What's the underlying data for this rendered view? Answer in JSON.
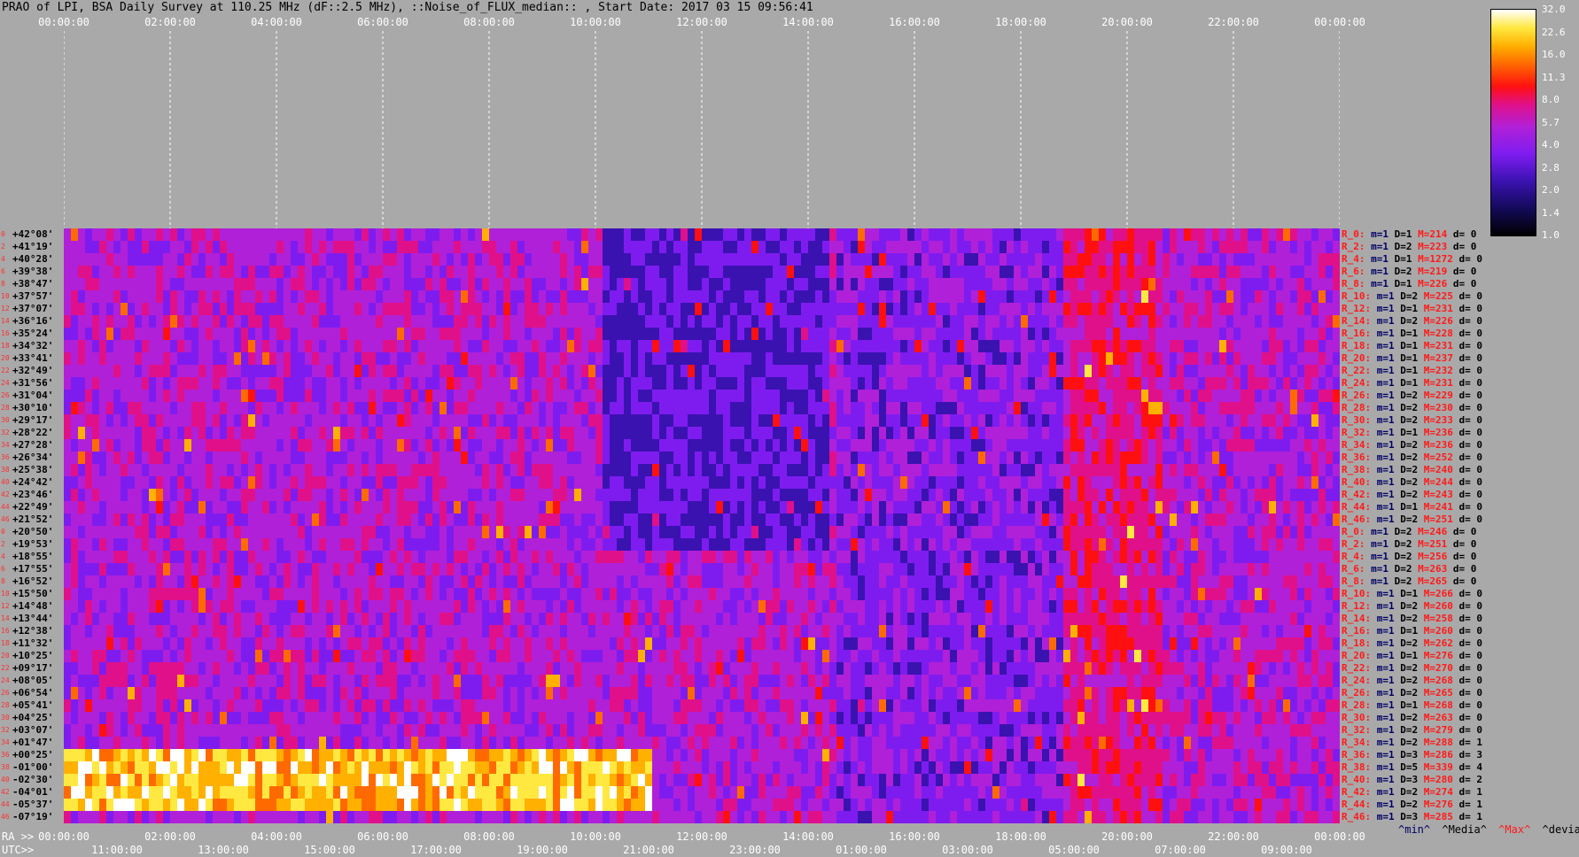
{
  "title": "PRAO of LPI, BSA Daily Survey at 110.25 MHz (dF::2.5 MHz), ::Noise_of_FLUX_median:: , Start Date: 2017 03 15 09:56:41",
  "chart_data": {
    "type": "heatmap",
    "title": "PRAO of LPI, BSA Daily Survey at 110.25 MHz (dF::2.5 MHz), ::Noise_of_FLUX_median:: , Start Date: 2017 03 15 09:56:41",
    "top_axis_ticks": [
      "00:00:00",
      "02:00:00",
      "04:00:00",
      "06:00:00",
      "08:00:00",
      "10:00:00",
      "12:00:00",
      "14:00:00",
      "16:00:00",
      "18:00:00",
      "20:00:00",
      "22:00:00",
      "00:00:00"
    ],
    "ra_axis_prefix": "RA >>",
    "ra_axis_ticks": [
      "00:00:00",
      "02:00:00",
      "04:00:00",
      "06:00:00",
      "08:00:00",
      "10:00:00",
      "12:00:00",
      "14:00:00",
      "16:00:00",
      "18:00:00",
      "20:00:00",
      "22:00:00",
      "00:00:00"
    ],
    "utc_axis_prefix": "UTC>>",
    "utc_axis_ticks": [
      "11:00:00",
      "13:00:00",
      "15:00:00",
      "17:00:00",
      "19:00:00",
      "21:00:00",
      "23:00:00",
      "01:00:00",
      "03:00:00",
      "05:00:00",
      "07:00:00",
      "09:00:00"
    ],
    "colorbar": {
      "ticks": [
        "32.0",
        "22.6",
        "16.0",
        "11.3",
        "8.0",
        "5.7",
        "4.0",
        "2.8",
        "2.0",
        "1.4",
        "1.0"
      ],
      "colors": [
        "#000000",
        "#3a12b0",
        "#7e1cf0",
        "#b020d8",
        "#e0108a",
        "#ff1010",
        "#ff6a00",
        "#ffb000",
        "#ffe840",
        "#ffffff"
      ]
    },
    "rows": [
      {
        "idx": "0",
        "dec": "+42°08'"
      },
      {
        "idx": "2",
        "dec": "+41°19'"
      },
      {
        "idx": "4",
        "dec": "+40°28'"
      },
      {
        "idx": "6",
        "dec": "+39°38'"
      },
      {
        "idx": "8",
        "dec": "+38°47'"
      },
      {
        "idx": "10",
        "dec": "+37°57'"
      },
      {
        "idx": "12",
        "dec": "+37°07'"
      },
      {
        "idx": "14",
        "dec": "+36°16'"
      },
      {
        "idx": "16",
        "dec": "+35°24'"
      },
      {
        "idx": "18",
        "dec": "+34°32'"
      },
      {
        "idx": "20",
        "dec": "+33°41'"
      },
      {
        "idx": "22",
        "dec": "+32°49'"
      },
      {
        "idx": "24",
        "dec": "+31°56'"
      },
      {
        "idx": "26",
        "dec": "+31°04'"
      },
      {
        "idx": "28",
        "dec": "+30°10'"
      },
      {
        "idx": "30",
        "dec": "+29°17'"
      },
      {
        "idx": "32",
        "dec": "+28°22'"
      },
      {
        "idx": "34",
        "dec": "+27°28'"
      },
      {
        "idx": "36",
        "dec": "+26°34'"
      },
      {
        "idx": "38",
        "dec": "+25°38'"
      },
      {
        "idx": "40",
        "dec": "+24°42'"
      },
      {
        "idx": "42",
        "dec": "+23°46'"
      },
      {
        "idx": "44",
        "dec": "+22°49'"
      },
      {
        "idx": "46",
        "dec": "+21°52'"
      },
      {
        "idx": "0",
        "dec": "+20°50'"
      },
      {
        "idx": "2",
        "dec": "+19°53'"
      },
      {
        "idx": "4",
        "dec": "+18°55'"
      },
      {
        "idx": "6",
        "dec": "+17°55'"
      },
      {
        "idx": "8",
        "dec": "+16°52'"
      },
      {
        "idx": "10",
        "dec": "+15°50'"
      },
      {
        "idx": "12",
        "dec": "+14°48'"
      },
      {
        "idx": "14",
        "dec": "+13°44'"
      },
      {
        "idx": "16",
        "dec": "+12°38'"
      },
      {
        "idx": "18",
        "dec": "+11°32'"
      },
      {
        "idx": "20",
        "dec": "+10°25'"
      },
      {
        "idx": "22",
        "dec": "+09°17'"
      },
      {
        "idx": "24",
        "dec": "+08°05'"
      },
      {
        "idx": "26",
        "dec": "+06°54'"
      },
      {
        "idx": "28",
        "dec": "+05°41'"
      },
      {
        "idx": "30",
        "dec": "+04°25'"
      },
      {
        "idx": "32",
        "dec": "+03°07'"
      },
      {
        "idx": "34",
        "dec": "+01°47'"
      },
      {
        "idx": "36",
        "dec": "+00°25'"
      },
      {
        "idx": "38",
        "dec": "-01°00'"
      },
      {
        "idx": "40",
        "dec": "-02°30'"
      },
      {
        "idx": "42",
        "dec": "-04°01'"
      },
      {
        "idx": "44",
        "dec": "-05°37'"
      },
      {
        "idx": "46",
        "dec": "-07°19'"
      }
    ],
    "stats": [
      {
        "r": "R_0:",
        "m": "m=1",
        "d": "D=1",
        "mx": "M=214",
        "dv": "d= 0"
      },
      {
        "r": "R_2:",
        "m": "m=1",
        "d": "D=2",
        "mx": "M=223",
        "dv": "d= 0"
      },
      {
        "r": "R_4:",
        "m": "m=1",
        "d": "D=1",
        "mx": "M=1272",
        "dv": "d= 0"
      },
      {
        "r": "R_6:",
        "m": "m=1",
        "d": "D=2",
        "mx": "M=219",
        "dv": "d= 0"
      },
      {
        "r": "R_8:",
        "m": "m=1",
        "d": "D=1",
        "mx": "M=226",
        "dv": "d= 0"
      },
      {
        "r": "R_10:",
        "m": "m=1",
        "d": "D=2",
        "mx": "M=225",
        "dv": "d= 0"
      },
      {
        "r": "R_12:",
        "m": "m=1",
        "d": "D=1",
        "mx": "M=231",
        "dv": "d= 0"
      },
      {
        "r": "R_14:",
        "m": "m=1",
        "d": "D=2",
        "mx": "M=226",
        "dv": "d= 0"
      },
      {
        "r": "R_16:",
        "m": "m=1",
        "d": "D=1",
        "mx": "M=228",
        "dv": "d= 0"
      },
      {
        "r": "R_18:",
        "m": "m=1",
        "d": "D=1",
        "mx": "M=231",
        "dv": "d= 0"
      },
      {
        "r": "R_20:",
        "m": "m=1",
        "d": "D=1",
        "mx": "M=237",
        "dv": "d= 0"
      },
      {
        "r": "R_22:",
        "m": "m=1",
        "d": "D=1",
        "mx": "M=232",
        "dv": "d= 0"
      },
      {
        "r": "R_24:",
        "m": "m=1",
        "d": "D=1",
        "mx": "M=231",
        "dv": "d= 0"
      },
      {
        "r": "R_26:",
        "m": "m=1",
        "d": "D=2",
        "mx": "M=229",
        "dv": "d= 0"
      },
      {
        "r": "R_28:",
        "m": "m=1",
        "d": "D=2",
        "mx": "M=230",
        "dv": "d= 0"
      },
      {
        "r": "R_30:",
        "m": "m=1",
        "d": "D=2",
        "mx": "M=233",
        "dv": "d= 0"
      },
      {
        "r": "R_32:",
        "m": "m=1",
        "d": "D=1",
        "mx": "M=236",
        "dv": "d= 0"
      },
      {
        "r": "R_34:",
        "m": "m=1",
        "d": "D=2",
        "mx": "M=236",
        "dv": "d= 0"
      },
      {
        "r": "R_36:",
        "m": "m=1",
        "d": "D=2",
        "mx": "M=252",
        "dv": "d= 0"
      },
      {
        "r": "R_38:",
        "m": "m=1",
        "d": "D=2",
        "mx": "M=240",
        "dv": "d= 0"
      },
      {
        "r": "R_40:",
        "m": "m=1",
        "d": "D=2",
        "mx": "M=244",
        "dv": "d= 0"
      },
      {
        "r": "R_42:",
        "m": "m=1",
        "d": "D=2",
        "mx": "M=243",
        "dv": "d= 0"
      },
      {
        "r": "R_44:",
        "m": "m=1",
        "d": "D=1",
        "mx": "M=241",
        "dv": "d= 0"
      },
      {
        "r": "R_46:",
        "m": "m=1",
        "d": "D=2",
        "mx": "M=251",
        "dv": "d= 0"
      },
      {
        "r": "R_0:",
        "m": "m=1",
        "d": "D=2",
        "mx": "M=246",
        "dv": "d= 0"
      },
      {
        "r": "R_2:",
        "m": "m=1",
        "d": "D=2",
        "mx": "M=251",
        "dv": "d= 0"
      },
      {
        "r": "R_4:",
        "m": "m=1",
        "d": "D=2",
        "mx": "M=256",
        "dv": "d= 0"
      },
      {
        "r": "R_6:",
        "m": "m=1",
        "d": "D=2",
        "mx": "M=263",
        "dv": "d= 0"
      },
      {
        "r": "R_8:",
        "m": "m=1",
        "d": "D=2",
        "mx": "M=265",
        "dv": "d= 0"
      },
      {
        "r": "R_10:",
        "m": "m=1",
        "d": "D=1",
        "mx": "M=266",
        "dv": "d= 0"
      },
      {
        "r": "R_12:",
        "m": "m=1",
        "d": "D=2",
        "mx": "M=260",
        "dv": "d= 0"
      },
      {
        "r": "R_14:",
        "m": "m=1",
        "d": "D=2",
        "mx": "M=258",
        "dv": "d= 0"
      },
      {
        "r": "R_16:",
        "m": "m=1",
        "d": "D=1",
        "mx": "M=260",
        "dv": "d= 0"
      },
      {
        "r": "R_18:",
        "m": "m=1",
        "d": "D=2",
        "mx": "M=262",
        "dv": "d= 0"
      },
      {
        "r": "R_20:",
        "m": "m=1",
        "d": "D=1",
        "mx": "M=276",
        "dv": "d= 0"
      },
      {
        "r": "R_22:",
        "m": "m=1",
        "d": "D=2",
        "mx": "M=270",
        "dv": "d= 0"
      },
      {
        "r": "R_24:",
        "m": "m=1",
        "d": "D=2",
        "mx": "M=268",
        "dv": "d= 0"
      },
      {
        "r": "R_26:",
        "m": "m=1",
        "d": "D=2",
        "mx": "M=265",
        "dv": "d= 0"
      },
      {
        "r": "R_28:",
        "m": "m=1",
        "d": "D=1",
        "mx": "M=268",
        "dv": "d= 0"
      },
      {
        "r": "R_30:",
        "m": "m=1",
        "d": "D=2",
        "mx": "M=263",
        "dv": "d= 0"
      },
      {
        "r": "R_32:",
        "m": "m=1",
        "d": "D=2",
        "mx": "M=279",
        "dv": "d= 0"
      },
      {
        "r": "R_34:",
        "m": "m=1",
        "d": "D=2",
        "mx": "M=288",
        "dv": "d= 1"
      },
      {
        "r": "R_36:",
        "m": "m=1",
        "d": "D=3",
        "mx": "M=286",
        "dv": "d= 3"
      },
      {
        "r": "R_38:",
        "m": "m=1",
        "d": "D=5",
        "mx": "M=339",
        "dv": "d= 4"
      },
      {
        "r": "R_40:",
        "m": "m=1",
        "d": "D=3",
        "mx": "M=280",
        "dv": "d= 2"
      },
      {
        "r": "R_42:",
        "m": "m=1",
        "d": "D=2",
        "mx": "M=274",
        "dv": "d= 1"
      },
      {
        "r": "R_44:",
        "m": "m=1",
        "d": "D=2",
        "mx": "M=276",
        "dv": "d= 1"
      },
      {
        "r": "R_46:",
        "m": "m=1",
        "d": "D=3",
        "mx": "M=285",
        "dv": "d= 1"
      }
    ],
    "stat_legend": {
      "min": "^min^",
      "median": "^Media^",
      "max": "^Max^",
      "devia": "^devia^"
    }
  }
}
